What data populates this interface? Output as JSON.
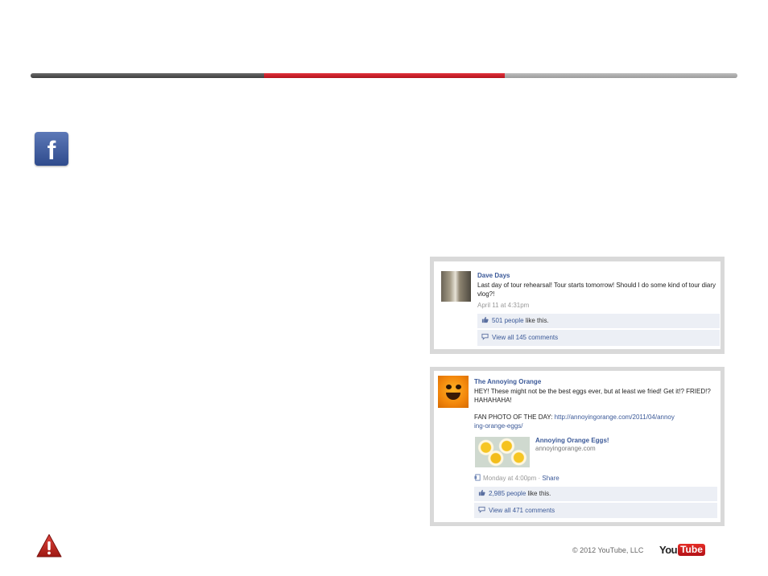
{
  "slide": {
    "progress": {
      "completed_fraction": 0.33,
      "current_section_fraction": 0.34
    },
    "brand_colors": {
      "facebook_blue": "#3b5998",
      "progress_red": "#d1212a",
      "youtube_red": "#d1242b"
    },
    "facebook_logo": {
      "letter": "f",
      "icon": "facebook-logo-icon"
    }
  },
  "posts": [
    {
      "author": "Dave Days",
      "message": "Last day of tour rehearsal! Tour starts tomorrow! Should I do some kind of tour diary vlog?!",
      "timestamp": "April 11 at 4:31pm",
      "likes_count": "501 people",
      "likes_suffix": " like this.",
      "comments_label": "View all 145 comments"
    },
    {
      "author": "The Annoying Orange",
      "message_line1": "HEY! These might not be the best eggs ever, but at least we fried! Get it!? FRIED!? HAHAHAHA!",
      "message_line2_prefix": "FAN PHOTO OF THE DAY: ",
      "link_url": "http://annoyingorange.com/2011/04/annoying-orange-eggs/",
      "attachment_title": "Annoying Orange Eggs!",
      "attachment_domain": "annoyingorange.com",
      "timestamp": "Monday at 4:00pm",
      "timestamp_sep": " · ",
      "share_label": "Share",
      "likes_count": "2,985 people",
      "likes_suffix": " like this.",
      "comments_label": "View all 471 comments"
    }
  ],
  "footer": {
    "copyright": "© 2012 YouTube, LLC",
    "logo_you": "You",
    "logo_tube": "Tube",
    "warning_icon": "warning-icon"
  }
}
